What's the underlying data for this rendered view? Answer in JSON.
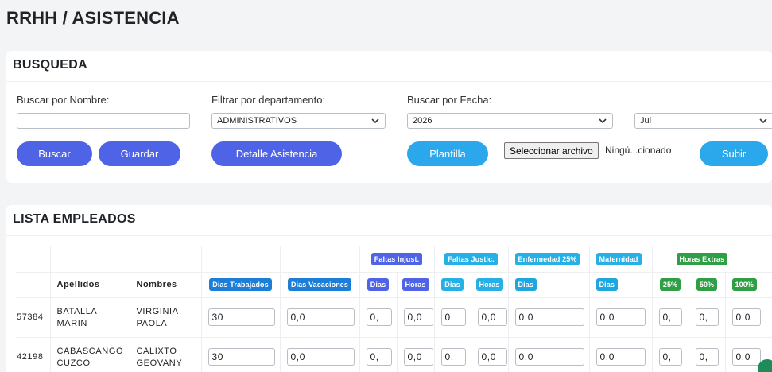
{
  "page": {
    "title": "RRHH / ASISTENCIA"
  },
  "search": {
    "header": "BUSQUEDA",
    "name_label": "Buscar por Nombre:",
    "name_value": "",
    "dept_label": "Filtrar por departamento:",
    "dept_selected": "ADMINISTRATIVOS",
    "date_label": "Buscar por Fecha:",
    "year_selected": "2026",
    "month_selected": "Jul",
    "buttons": {
      "buscar": "Buscar",
      "guardar": "Guardar",
      "detalle": "Detalle Asistencia",
      "plantilla": "Plantilla",
      "subir": "Subir"
    },
    "file_button": "Seleccionar archivo",
    "file_status": "Ningú...cionado"
  },
  "list": {
    "header": "LISTA EMPLEADOS",
    "groups": {
      "faltas_injust": "Faltas Injust.",
      "faltas_justic": "Faltas Justic.",
      "enfermedad": "Enfermedad 25%",
      "maternidad": "Maternidad",
      "horas_extras": "Horas Extras"
    },
    "columns": {
      "apellidos": "Apellidos",
      "nombres": "Nombres",
      "dias_trabajados": "Dias Trabajados",
      "dias_vacaciones": "Dias Vacaciones",
      "dias": "Dias",
      "horas": "Horas",
      "p25": "25%",
      "p50": "50%",
      "p100": "100%"
    },
    "rows": [
      {
        "code": "57384",
        "apellidos_1": "BATALLA",
        "apellidos_2": "MARIN",
        "nombres_1": "VIRGINIA",
        "nombres_2": "PAOLA",
        "dias_trabajados": "30",
        "dias_vacaciones": "0,0",
        "fi_dias": "0,",
        "fi_horas": "0,0",
        "fj_dias": "0,",
        "fj_horas": "0,0",
        "enf_dias": "0,0",
        "mat_dias": "0,0",
        "he_25": "0,",
        "he_50": "0,",
        "he_100": "0,0"
      },
      {
        "code": "42198",
        "apellidos_1": "CABASCANGO",
        "apellidos_2": "CUZCO",
        "nombres_1": "CALIXTO",
        "nombres_2": "GEOVANY",
        "dias_trabajados": "30",
        "dias_vacaciones": "0,0",
        "fi_dias": "0,",
        "fi_horas": "0,0",
        "fj_dias": "0,",
        "fj_horas": "0,0",
        "enf_dias": "0,0",
        "mat_dias": "0,0",
        "he_25": "0,",
        "he_50": "0,",
        "he_100": "0,0"
      }
    ]
  }
}
